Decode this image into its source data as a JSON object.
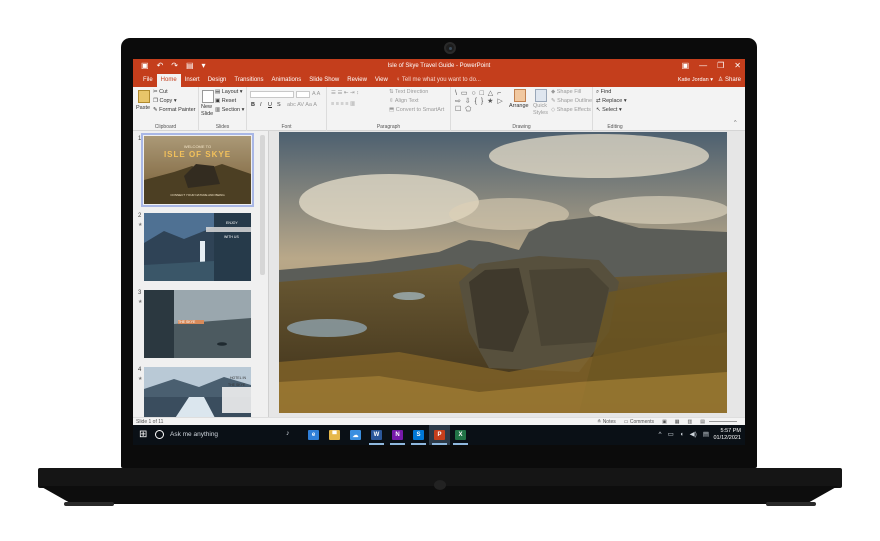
{
  "titlebar": {
    "document_title": "Isle of Skye Travel Guide - PowerPoint",
    "qat_icons": [
      "save-icon",
      "undo-icon",
      "redo-icon",
      "start-from-beginning-icon",
      "customize-qat-icon"
    ],
    "minimize": "—",
    "restore": "❐",
    "close": "✕"
  },
  "tabs": {
    "items": [
      "File",
      "Home",
      "Insert",
      "Design",
      "Transitions",
      "Animations",
      "Slide Show",
      "Review",
      "View"
    ],
    "active": "Home",
    "tell_me": "Tell me what you want to do...",
    "user": "Katie Jordan",
    "share": "Share"
  },
  "ribbon": {
    "clipboard": {
      "label": "Clipboard",
      "paste": "Paste",
      "cut": "Cut",
      "copy": "Copy",
      "format_painter": "Format Painter"
    },
    "slides": {
      "label": "Slides",
      "new_slide_1": "New",
      "new_slide_2": "Slide",
      "layout": "Layout",
      "reset": "Reset",
      "section": "Section"
    },
    "font": {
      "label": "Font",
      "bold": "B",
      "italic": "I",
      "underline": "U",
      "strike": "S"
    },
    "paragraph": {
      "label": "Paragraph",
      "text_direction": "Text Direction",
      "align_text": "Align Text",
      "convert_smartart": "Convert to SmartArt"
    },
    "drawing": {
      "label": "Drawing",
      "shapes_glyphs": "\\ ▭ ○ □ △ ⌐ ⇨ ⇩ { } ★ ▷ ☐ ⬠",
      "arrange": "Arrange",
      "quick_styles_1": "Quick",
      "quick_styles_2": "Styles",
      "shape_fill": "Shape Fill",
      "shape_outline": "Shape Outline",
      "shape_effects": "Shape Effects"
    },
    "editing": {
      "label": "Editing",
      "find": "Find",
      "replace": "Replace",
      "select": "Select"
    }
  },
  "thumbnails": [
    {
      "number": "1",
      "title_small": "WELCOME TO",
      "title_big": "ISLE OF SKYE",
      "subtitle": "CONNECT YOUR NATURE AND BEING"
    },
    {
      "number": "2",
      "line1": "ENJOY",
      "line2": "WITH US"
    },
    {
      "number": "3",
      "caption": "THE SKYE"
    },
    {
      "number": "4",
      "line1": "HOTEL IN",
      "line2": "THE SKYE"
    }
  ],
  "statusbar": {
    "slide_info": "Slide 1 of 11",
    "notes": "Notes",
    "comments": "Comments"
  },
  "taskbar": {
    "search_placeholder": "Ask me anything",
    "apps": [
      {
        "icon": "edge-icon",
        "glyph": "e",
        "color": "#2f7fd8"
      },
      {
        "icon": "file-explorer-icon",
        "glyph": "▀",
        "color": "#e6b84a"
      },
      {
        "icon": "onedrive-icon",
        "glyph": "☁",
        "color": "#3a8fe0"
      },
      {
        "icon": "word-icon",
        "glyph": "W",
        "color": "#2b579a"
      },
      {
        "icon": "onenote-icon",
        "glyph": "N",
        "color": "#7719aa"
      },
      {
        "icon": "skype-icon",
        "glyph": "S",
        "color": "#0078d7"
      },
      {
        "icon": "powerpoint-icon",
        "glyph": "P",
        "color": "#c43e1c"
      },
      {
        "icon": "excel-icon",
        "glyph": "X",
        "color": "#217346"
      }
    ],
    "tray": [
      "^",
      "▭",
      "◖",
      "◀)",
      "▤"
    ],
    "time": "5:57 PM",
    "date": "01/12/2021"
  }
}
